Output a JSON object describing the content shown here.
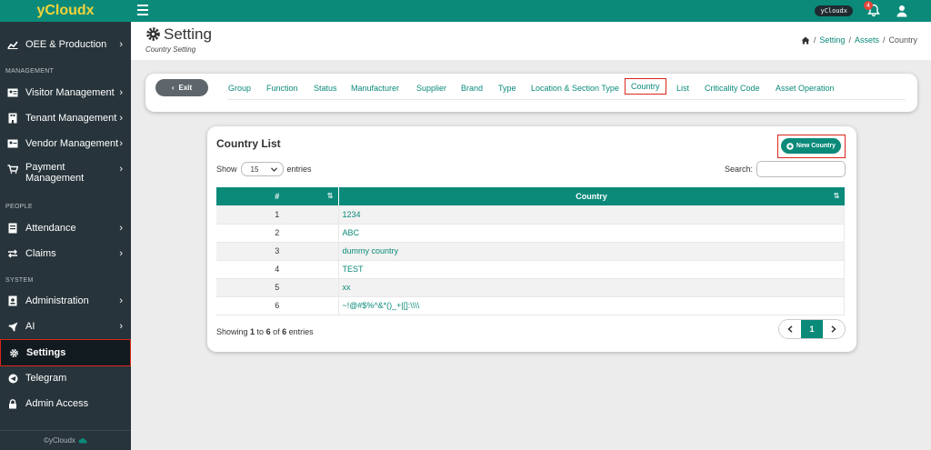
{
  "app": {
    "brand": "yCloudx",
    "footer": "©yCloudx"
  },
  "topbar": {
    "user_pill": "yCloudx",
    "notification_count": "4"
  },
  "sidebar": {
    "top_item": {
      "label": "OEE & Production"
    },
    "sections": {
      "management": "MANAGEMENT",
      "people": "PEOPLE",
      "system": "SYSTEM"
    },
    "management_items": [
      {
        "label": "Visitor Management"
      },
      {
        "label": "Tenant Management"
      },
      {
        "label": "Vendor Management"
      },
      {
        "label": "Payment Management"
      }
    ],
    "people_items": [
      {
        "label": "Attendance"
      },
      {
        "label": "Claims"
      }
    ],
    "system_items": [
      {
        "label": "Administration"
      },
      {
        "label": "AI"
      },
      {
        "label": "Settings"
      },
      {
        "label": "Telegram"
      },
      {
        "label": "Admin Access"
      }
    ]
  },
  "header": {
    "title": "Setting",
    "subtitle": "Country Setting",
    "breadcrumb": [
      "Setting",
      "Assets",
      "Country"
    ]
  },
  "tabs": {
    "exit_label": "Exit",
    "items": [
      {
        "label": "Group"
      },
      {
        "label": "Function"
      },
      {
        "label": "Status"
      },
      {
        "label": "Manufacturer"
      },
      {
        "label": "Supplier"
      },
      {
        "label": "Brand"
      },
      {
        "label": "Type"
      },
      {
        "label": "Location & Section Type"
      },
      {
        "label": "Country"
      },
      {
        "label": "List"
      },
      {
        "label": "Criticality Code"
      },
      {
        "label": "Asset Operation"
      }
    ],
    "active": "Country"
  },
  "list": {
    "title": "Country List",
    "new_button": "New Country",
    "show_label": "Show",
    "entries_value": "15",
    "entries_label": "entries",
    "search_label": "Search:",
    "columns": [
      "#",
      "Country"
    ],
    "rows": [
      {
        "num": "1",
        "country": "1234"
      },
      {
        "num": "2",
        "country": "ABC"
      },
      {
        "num": "3",
        "country": "dummy country"
      },
      {
        "num": "4",
        "country": "TEST"
      },
      {
        "num": "5",
        "country": "xx"
      },
      {
        "num": "6",
        "country": "~!@#$%^&*()_+|[]:\\\\\\\\"
      }
    ],
    "showing": {
      "prefix": "Showing ",
      "from": "1",
      "to_word": " to ",
      "to": "6",
      "of_word": " of ",
      "total": "6",
      "suffix": " entries"
    },
    "current_page": "1"
  }
}
